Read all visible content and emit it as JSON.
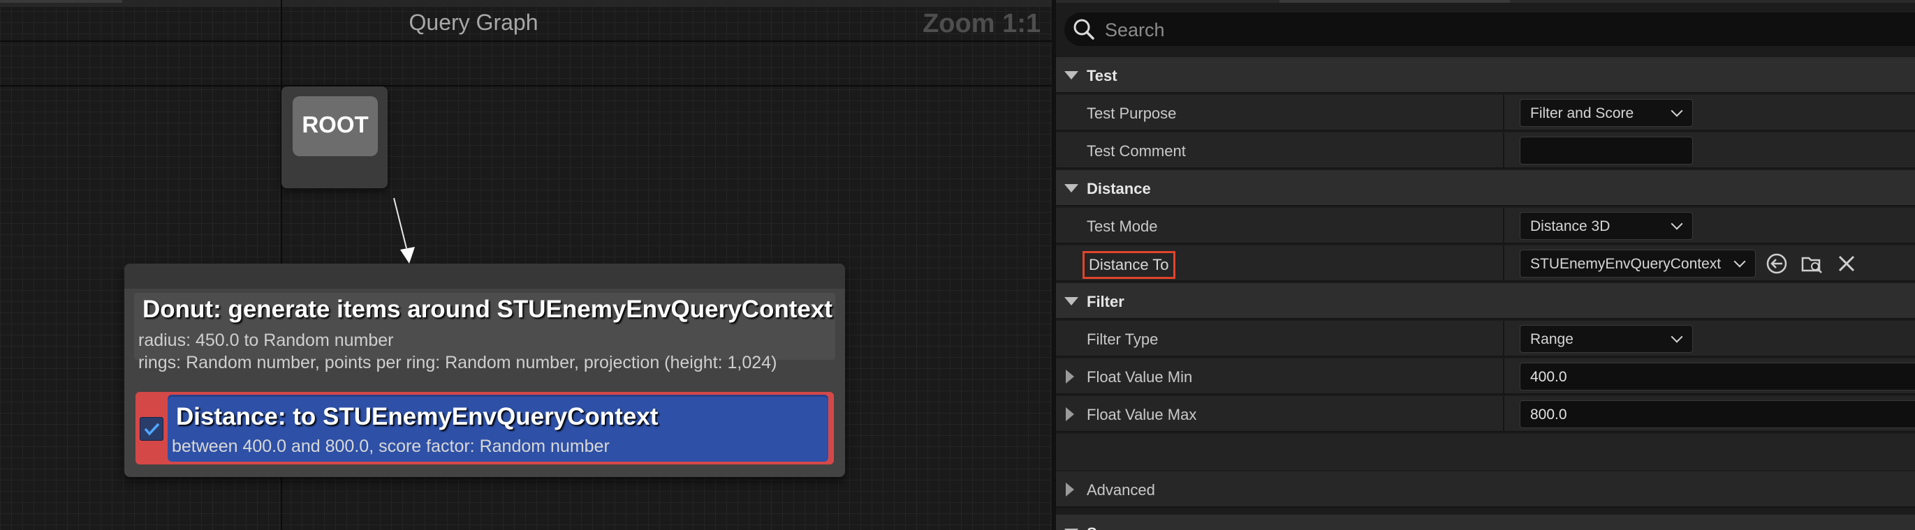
{
  "graph": {
    "title": "Query Graph",
    "zoom": "Zoom 1:1",
    "root_label": "ROOT",
    "generator": {
      "title": "Donut: generate items around STUEnemyEnvQueryContext",
      "line1": "radius: 450.0 to Random number",
      "line2": "rings: Random number, points per ring: Random number, projection (height: 1,024)"
    },
    "test": {
      "enabled": true,
      "title": "Distance: to STUEnemyEnvQueryContext",
      "desc": "between 400.0 and 800.0, score factor: Random number"
    }
  },
  "details": {
    "search_placeholder": "Search",
    "categories": {
      "test": "Test",
      "distance": "Distance",
      "filter": "Filter",
      "advanced": "Advanced",
      "score": "Score"
    },
    "props": {
      "test_purpose": {
        "label": "Test Purpose",
        "value": "Filter and Score"
      },
      "test_comment": {
        "label": "Test Comment",
        "value": ""
      },
      "test_mode": {
        "label": "Test Mode",
        "value": "Distance 3D"
      },
      "distance_to": {
        "label": "Distance To",
        "value": "STUEnemyEnvQueryContext"
      },
      "filter_type": {
        "label": "Filter Type",
        "value": "Range"
      },
      "float_min": {
        "label": "Float Value Min",
        "value": "400.0"
      },
      "float_max": {
        "label": "Float Value Max",
        "value": "800.0"
      }
    }
  },
  "colors": {
    "selected_outline": "#d54848",
    "test_fill": "#2e50a6",
    "highlight_border": "#e0442c"
  }
}
